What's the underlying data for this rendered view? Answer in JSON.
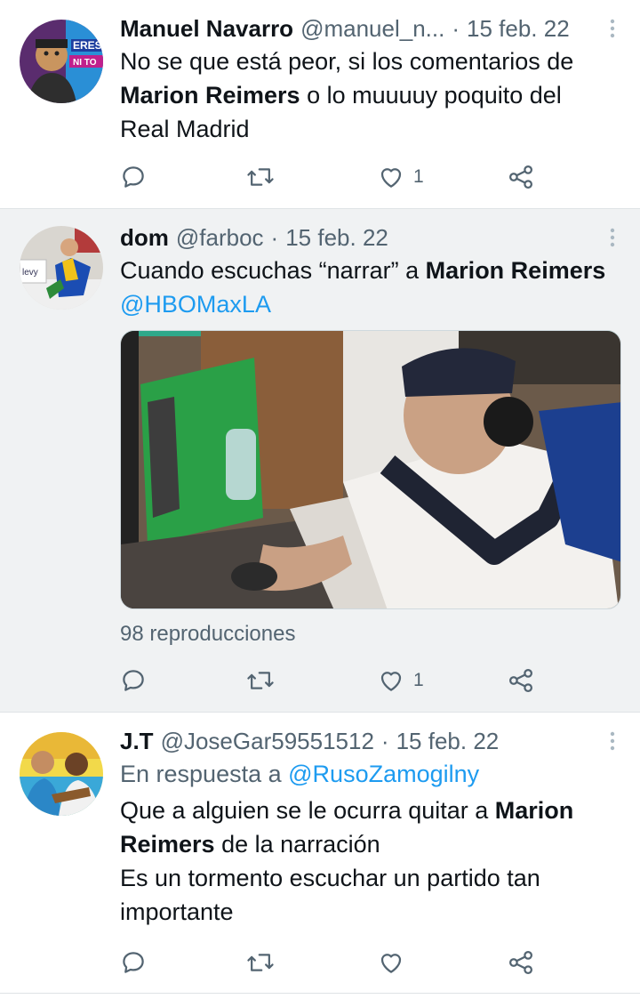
{
  "tweets": [
    {
      "name": "Manuel Navarro",
      "handle": "@manuel_n...",
      "sep": "·",
      "date": "15 feb. 22",
      "text_lines": [
        [
          {
            "t": "No se que está peor, si los comentarios de",
            "b": false
          }
        ],
        [
          {
            "t": "Marion Reimers",
            "b": true
          },
          {
            "t": " o lo muuuuy poquito del",
            "b": false
          }
        ],
        [
          {
            "t": "Real Madrid",
            "b": false
          }
        ]
      ],
      "likes": "1"
    },
    {
      "name": "dom",
      "handle": "@farboc",
      "sep": "·",
      "date": "15 feb. 22",
      "text_lines": [
        [
          {
            "t": "Cuando escuchas “narrar” a ",
            "b": false
          },
          {
            "t": "Marion Reimers",
            "b": true
          }
        ],
        [
          {
            "t": "@HBOMaxLA",
            "b": false,
            "link": true
          }
        ]
      ],
      "views": "98 reproducciones",
      "likes": "1"
    },
    {
      "name": "J.T",
      "handle": "@JoseGar59551512",
      "sep": "·",
      "date": "15 feb. 22",
      "reply_prefix": "En respuesta a",
      "reply_to": "@RusoZamogilny",
      "text_lines": [
        [
          {
            "t": "Que a alguien se le ocurra quitar a ",
            "b": false
          },
          {
            "t": "Marion",
            "b": true
          }
        ],
        [
          {
            "t": "Reimers",
            "b": true
          },
          {
            "t": " de la narración",
            "b": false
          }
        ],
        [
          {
            "t": "Es un tormento escuchar un partido tan",
            "b": false
          }
        ],
        [
          {
            "t": "importante",
            "b": false
          }
        ]
      ],
      "likes": ""
    }
  ],
  "icons": {
    "reply": "comment-bubble-icon",
    "retweet": "retweet-icon",
    "like": "heart-icon",
    "share": "share-icon",
    "more": "more-vertical-icon"
  },
  "colors": {
    "text": "#0f1419",
    "secondary": "#536471",
    "link": "#1d9bf0",
    "highlight_bg": "#f0f2f3",
    "divider": "#dfe3e6"
  }
}
